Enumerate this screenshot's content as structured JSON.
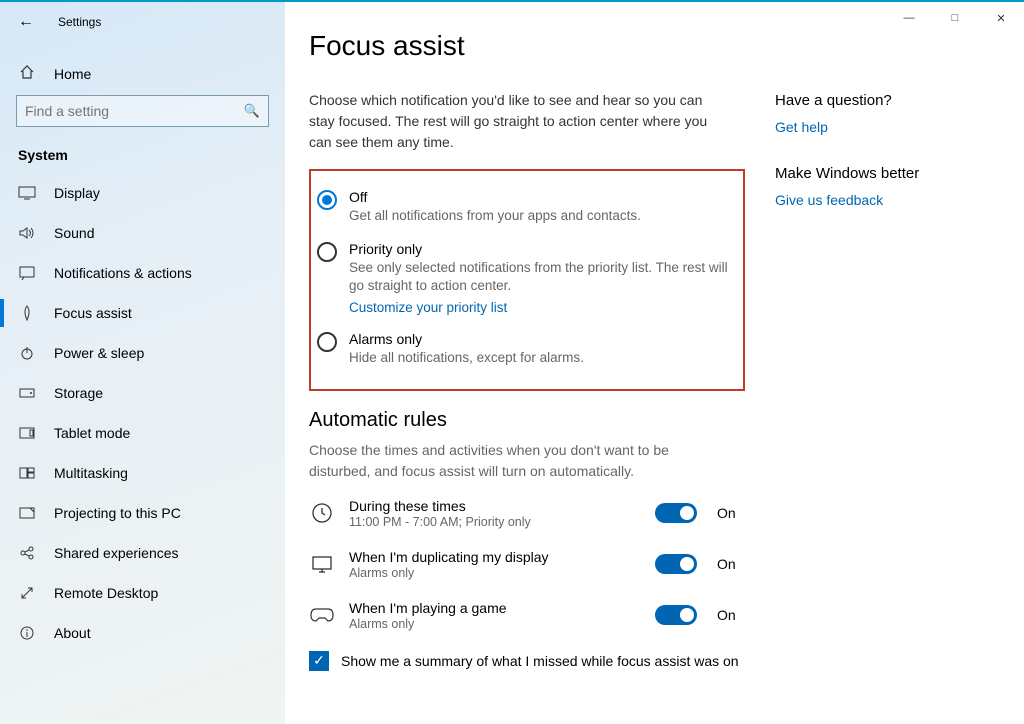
{
  "app_title": "Settings",
  "home_label": "Home",
  "search_placeholder": "Find a setting",
  "category": "System",
  "sidebar": {
    "items": [
      {
        "label": "Display"
      },
      {
        "label": "Sound"
      },
      {
        "label": "Notifications & actions"
      },
      {
        "label": "Focus assist"
      },
      {
        "label": "Power & sleep"
      },
      {
        "label": "Storage"
      },
      {
        "label": "Tablet mode"
      },
      {
        "label": "Multitasking"
      },
      {
        "label": "Projecting to this PC"
      },
      {
        "label": "Shared experiences"
      },
      {
        "label": "Remote Desktop"
      },
      {
        "label": "About"
      }
    ]
  },
  "page": {
    "title": "Focus assist",
    "intro": "Choose which notification you'd like to see and hear so you can stay focused. The rest will go straight to action center where you can see them any time.",
    "radios": {
      "off": {
        "title": "Off",
        "sub": "Get all notifications from your apps and contacts."
      },
      "priority": {
        "title": "Priority only",
        "sub": "See only selected notifications from the priority list. The rest will go straight to action center.",
        "link": "Customize your priority list"
      },
      "alarms": {
        "title": "Alarms only",
        "sub": "Hide all notifications, except for alarms."
      }
    },
    "rules_header": "Automatic rules",
    "rules_intro": "Choose the times and activities when you don't want to be disturbed, and focus assist will turn on automatically.",
    "rules": [
      {
        "title": "During these times",
        "sub": "11:00 PM - 7:00 AM; Priority only",
        "state": "On"
      },
      {
        "title": "When I'm duplicating my display",
        "sub": "Alarms only",
        "state": "On"
      },
      {
        "title": "When I'm playing a game",
        "sub": "Alarms only",
        "state": "On"
      }
    ],
    "summary_checkbox": "Show me a summary of what I missed while focus assist was on"
  },
  "aside": {
    "q_header": "Have a question?",
    "q_link": "Get help",
    "fb_header": "Make Windows better",
    "fb_link": "Give us feedback"
  }
}
